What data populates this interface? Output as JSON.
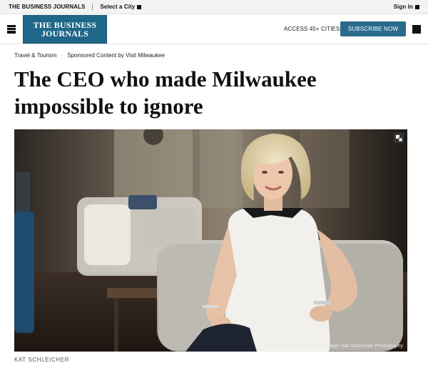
{
  "topbar": {
    "brand": "THE BUSINESS JOURNALS",
    "city_label": "Select a City",
    "signin_label": "Sign In"
  },
  "header": {
    "logo_line1": "THE BUSINESS",
    "logo_line2": "JOURNALS",
    "access_label": "ACCESS 45+ CITIES",
    "subscribe_label": "SUBSCRIBE NOW"
  },
  "breadcrumb": {
    "category": "Travel & Tourism",
    "sponsor": "Sponsored Content by Visit Milwaukee"
  },
  "article": {
    "headline_line1": "The CEO who made Milwaukee",
    "headline_line2": "impossible to ignore",
    "image_credit": "Image: Kat Schleicher Photography",
    "caption_name": "KAT SCHLEICHER"
  },
  "colors": {
    "brand_blue": "#1f6788",
    "subscribe_blue": "#2a6b8c",
    "topbar_bg": "#f3f3f3"
  },
  "icons": {
    "menu": "hamburger-icon",
    "expand": "expand-icon"
  }
}
